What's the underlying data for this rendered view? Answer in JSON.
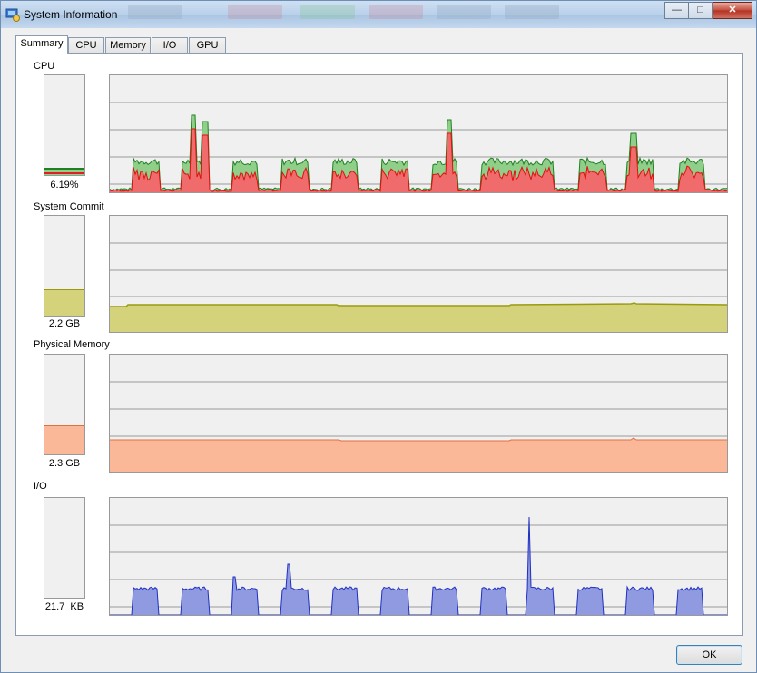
{
  "window": {
    "title": "System Information"
  },
  "tabs": [
    {
      "label": "Summary",
      "active": true
    },
    {
      "label": "CPU",
      "active": false
    },
    {
      "label": "Memory",
      "active": false
    },
    {
      "label": "I/O",
      "active": false
    },
    {
      "label": "GPU",
      "active": false
    }
  ],
  "sections": {
    "cpu": {
      "label": "CPU",
      "value": "6.19%",
      "level": 0.062
    },
    "commit": {
      "label": "System Commit",
      "value": "2.2 GB",
      "level": 0.26
    },
    "physical": {
      "label": "Physical Memory",
      "value": "2.3 GB",
      "level": 0.29
    },
    "io": {
      "label": "I/O",
      "value": "21.7  KB",
      "level": 0.0
    }
  },
  "colors": {
    "cpu_total": "#8fcf8a",
    "cpu_kernel": "#f06b6b",
    "commit_fill": "#d4d27a",
    "commit_line": "#9a9a10",
    "physical_fill": "#fbb898",
    "physical_line": "#e07040",
    "io_fill": "#8f9ae0",
    "io_line": "#2030c0",
    "grid": "#9a9a9a"
  },
  "footer": {
    "ok_label": "OK"
  }
}
